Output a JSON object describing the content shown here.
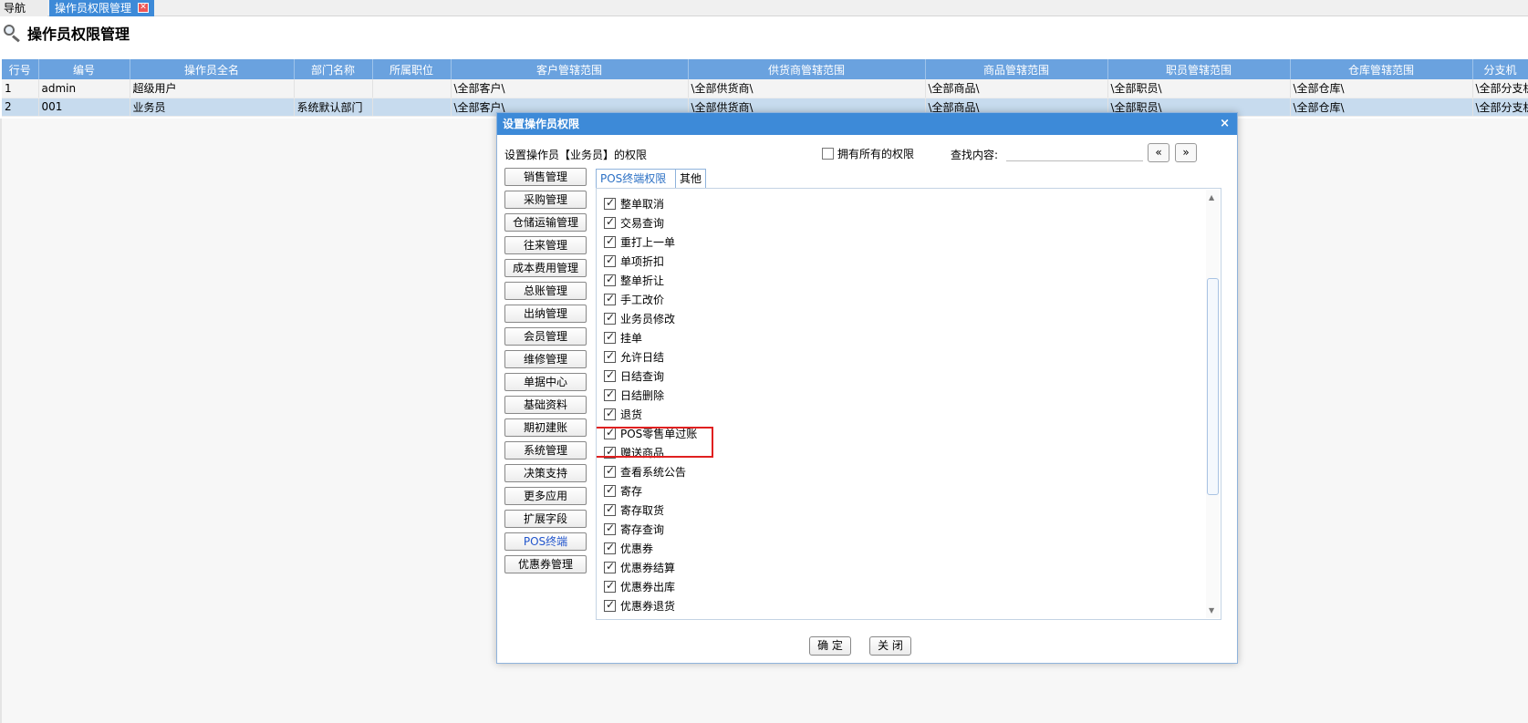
{
  "tabs": {
    "nav_label": "导航",
    "active_label": "操作员权限管理",
    "close_glyph": "✕"
  },
  "page": {
    "title": "操作员权限管理"
  },
  "grid": {
    "columns": [
      "行号",
      "编号",
      "操作员全名",
      "部门名称",
      "所属职位",
      "客户管辖范围",
      "供货商管辖范围",
      "商品管辖范围",
      "职员管辖范围",
      "仓库管辖范围",
      "分支机"
    ],
    "rows": [
      [
        "1",
        "admin",
        "超级用户",
        "",
        "",
        "\\全部客户\\",
        "\\全部供货商\\",
        "\\全部商品\\",
        "\\全部职员\\",
        "\\全部仓库\\",
        "\\全部分支机"
      ],
      [
        "2",
        "001",
        "业务员",
        "系统默认部门",
        "",
        "\\全部客户\\",
        "\\全部供货商\\",
        "\\全部商品\\",
        "\\全部职员\\",
        "\\全部仓库\\",
        "\\全部分支机"
      ]
    ]
  },
  "dialog": {
    "title": "设置操作员权限",
    "close_glyph": "×",
    "caption": "设置操作员【业务员】的权限",
    "own_all_label": "拥有所有的权限",
    "search_label": "查找内容:",
    "search_value": "",
    "prev_label": "«",
    "next_label": "»",
    "menu": [
      "销售管理",
      "采购管理",
      "仓储运输管理",
      "往来管理",
      "成本费用管理",
      "总账管理",
      "出纳管理",
      "会员管理",
      "维修管理",
      "单据中心",
      "基础资料",
      "期初建账",
      "系统管理",
      "决策支持",
      "更多应用",
      "扩展字段",
      "POS终端",
      "优惠券管理"
    ],
    "active_menu": "POS终端",
    "perm_tabs": [
      "POS终端权限",
      "其他"
    ],
    "permissions": [
      "整单取消",
      "交易查询",
      "重打上一单",
      "单项折扣",
      "整单折让",
      "手工改价",
      "业务员修改",
      "挂单",
      "允许日结",
      "日结查询",
      "日结删除",
      "退货",
      "POS零售单过账",
      "赠送商品",
      "查看系统公告",
      "寄存",
      "寄存取货",
      "寄存查询",
      "优惠券",
      "优惠券结算",
      "优惠券出库",
      "优惠券退货"
    ],
    "highlighted_permission": "POS零售单过账",
    "ok_label": "确 定",
    "close_label": "关 闭"
  }
}
